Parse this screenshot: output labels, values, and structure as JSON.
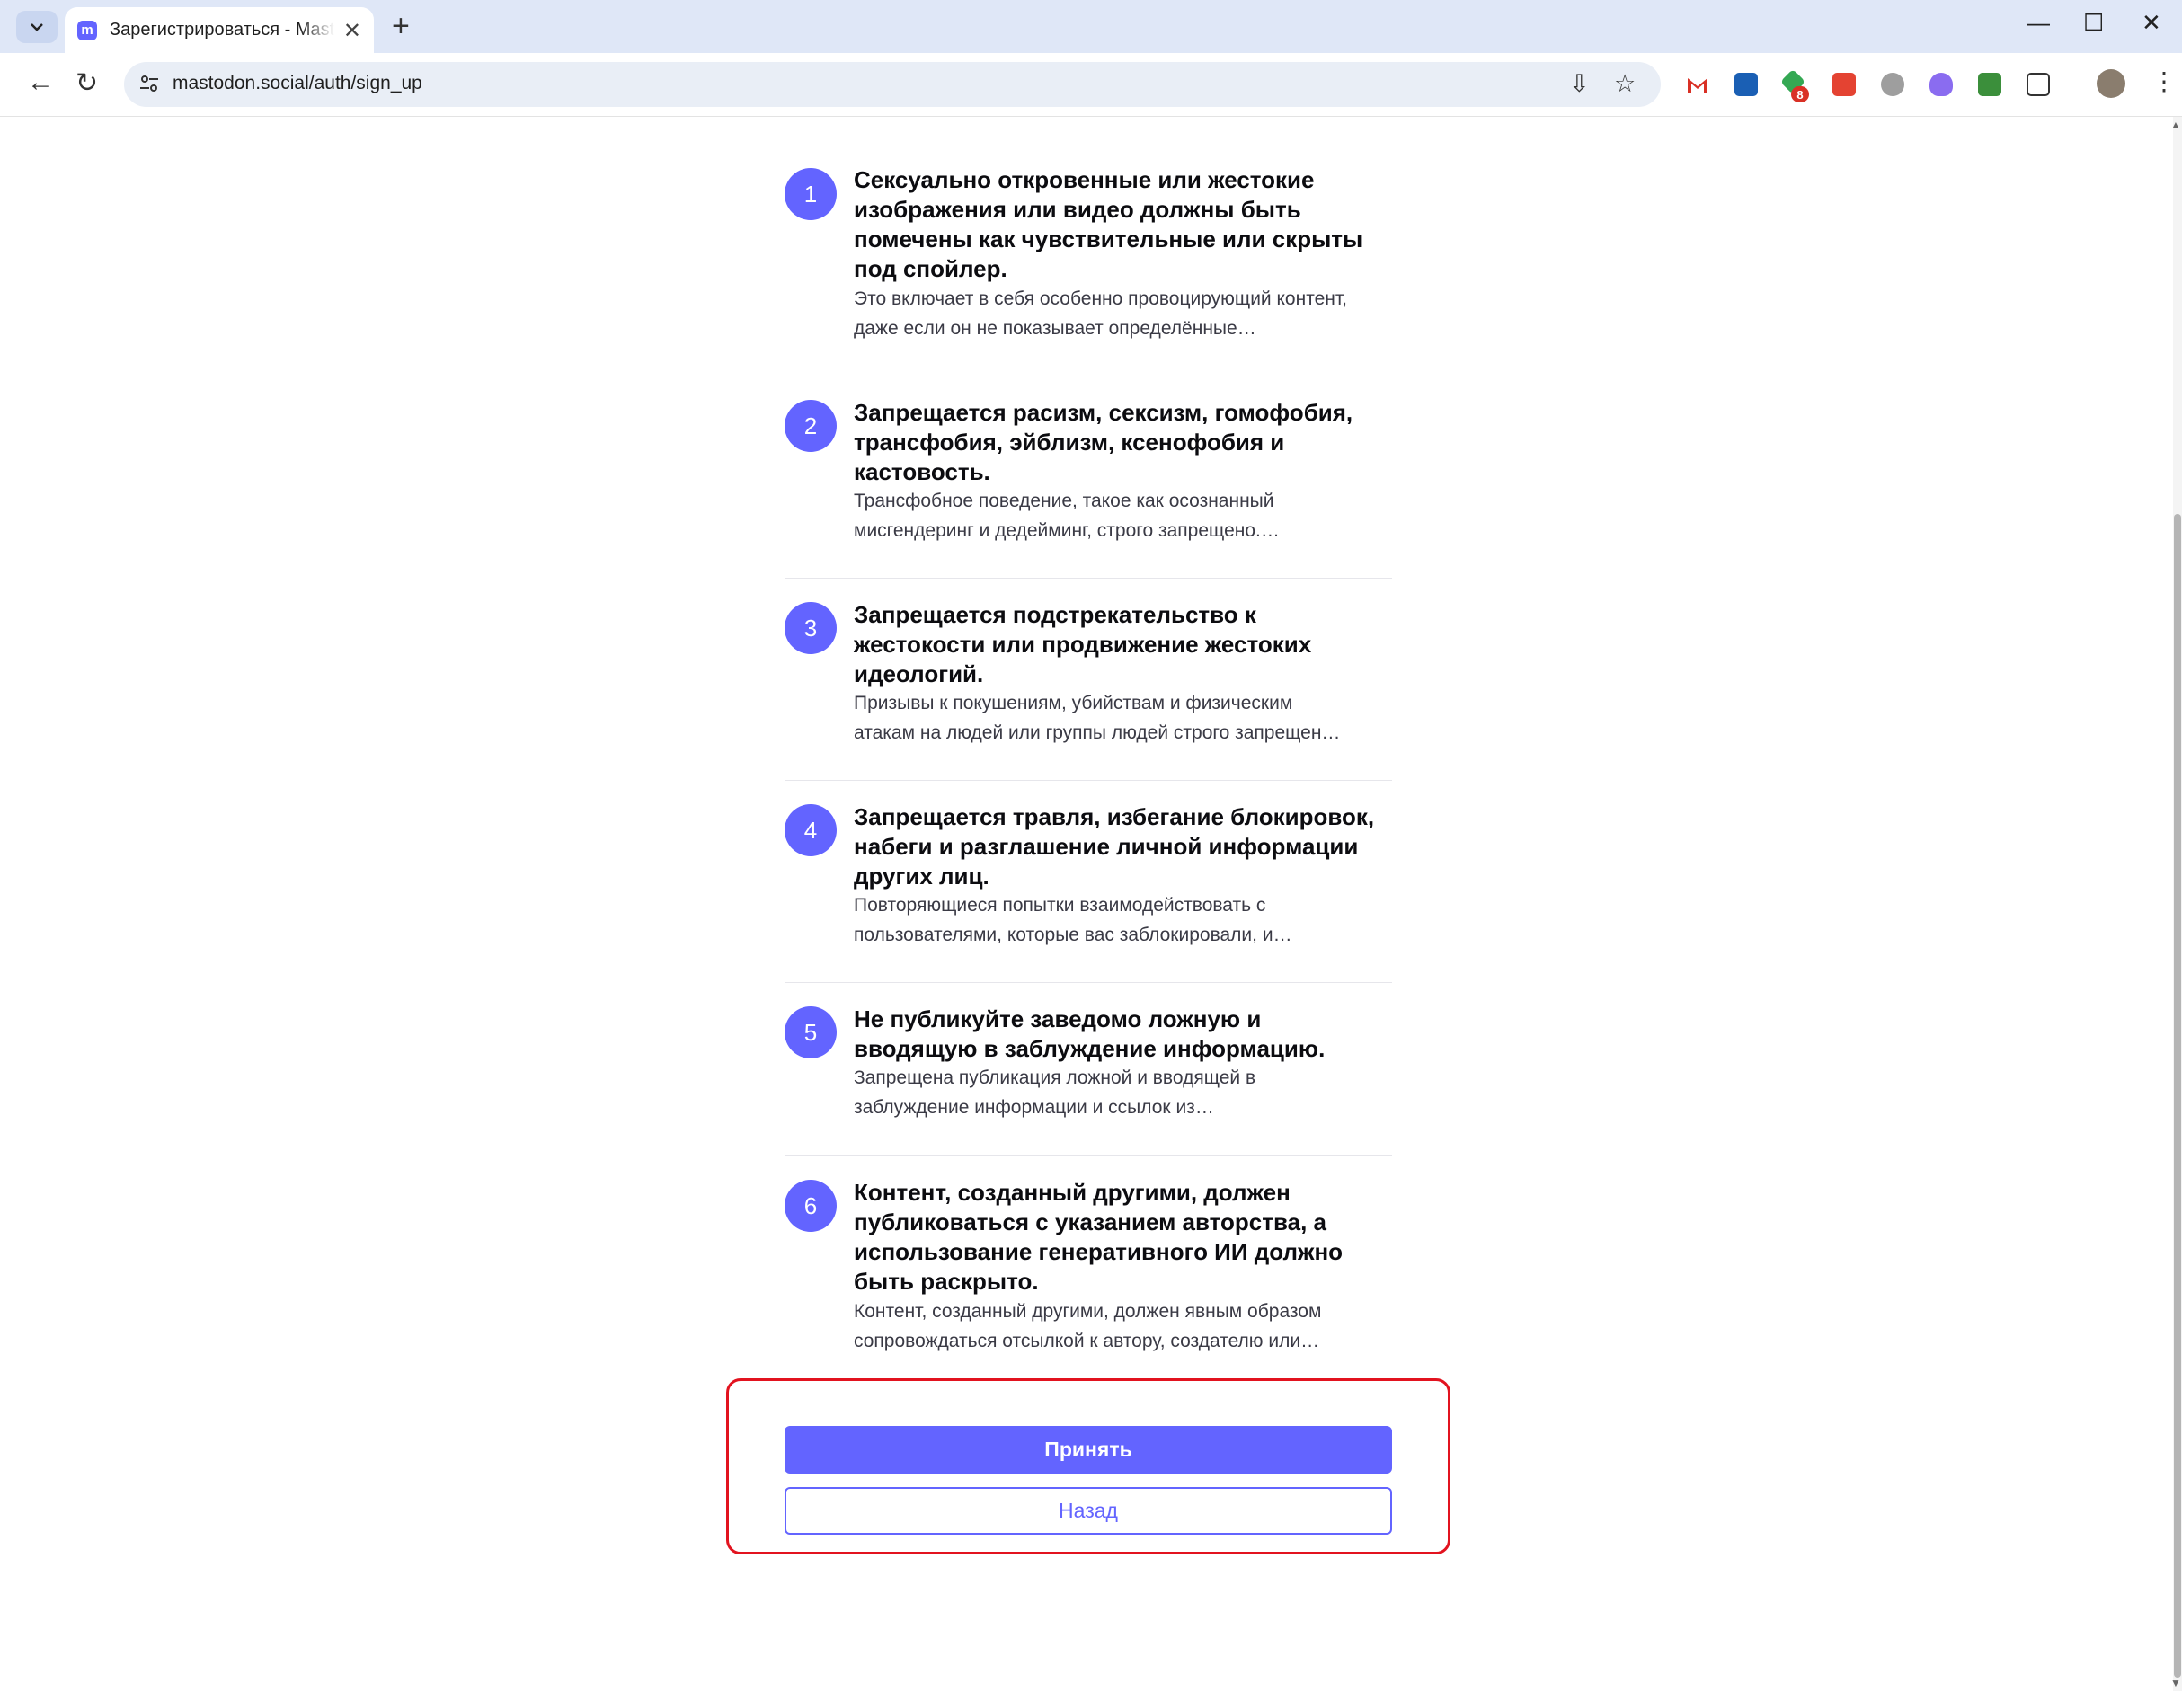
{
  "browser": {
    "tab_title": "Зарегистрироваться - Mastodon",
    "url": "mastodon.social/auth/sign_up",
    "extension_badge": "8"
  },
  "rules": [
    {
      "number": "1",
      "title": "Сексуально откровенные или жестокие изображения или видео должны быть помечены как чувствительные или скрыты под спойлер.",
      "description": "Это включает в себя особенно провоцирующий контент, даже если он не показывает определённые…"
    },
    {
      "number": "2",
      "title": "Запрещается расизм, сексизм, гомофобия, трансфобия, эйблизм, ксенофобия и кастовость.",
      "description": "Трансфобное поведение, такое как осознанный мисгендеринг и дедейминг, строго запрещено.…"
    },
    {
      "number": "3",
      "title": "Запрещается подстрекательство к жестокости или продвижение жестоких идеологий.",
      "description": "Призывы к покушениям, убийствам и физическим атакам на людей или группы людей строго запрещен…"
    },
    {
      "number": "4",
      "title": "Запрещается травля, избегание блокировок, набеги и разглашение личной информации других лиц.",
      "description": "Повторяющиеся попытки взаимодействовать с пользователями, которые вас заблокировали, и…"
    },
    {
      "number": "5",
      "title": "Не публикуйте заведомо ложную и вводящую в заблуждение информацию.",
      "description": "Запрещена публикация ложной и вводящей в заблуждение информации и ссылок из…"
    },
    {
      "number": "6",
      "title": "Контент, созданный другими, должен публиковаться с указанием авторства, а использование генеративного ИИ должно быть раскрыто.",
      "description": "Контент, созданный другими, должен явным образом сопровождаться отсылкой к автору, создателю или…"
    }
  ],
  "actions": {
    "accept_label": "Принять",
    "back_label": "Назад"
  },
  "colors": {
    "accent": "#6364ff",
    "highlight_border": "#e2131f"
  }
}
